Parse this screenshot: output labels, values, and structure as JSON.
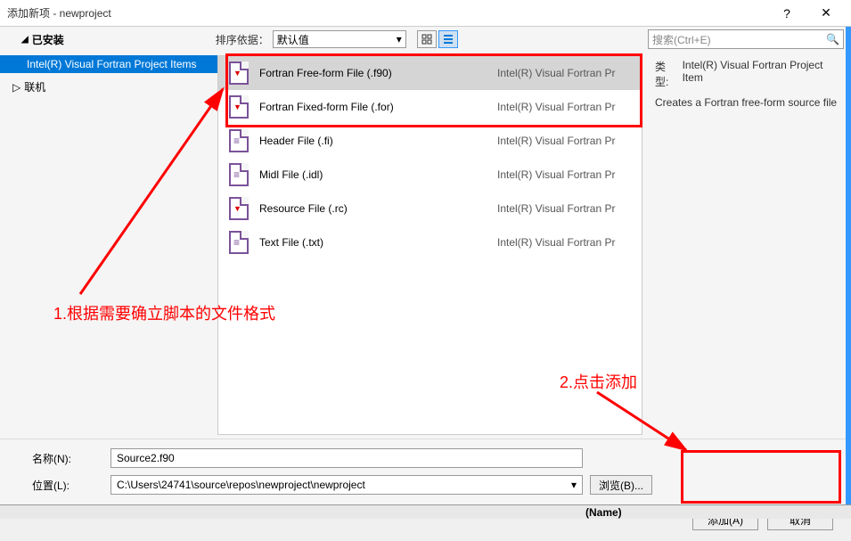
{
  "titlebar": {
    "title": "添加新项 - newproject",
    "help": "?",
    "close": "✕"
  },
  "toolbar": {
    "installed_label": "已安装",
    "sort_label": "排序依据：",
    "sort_value": "默认值",
    "search_placeholder": "搜索(Ctrl+E)"
  },
  "sidebar": {
    "items": [
      {
        "label": "Intel(R) Visual Fortran Project Items"
      }
    ],
    "online_label": "联机"
  },
  "templates": [
    {
      "name": "Fortran Free-form File (.f90)",
      "category": "Intel(R) Visual Fortran Pr",
      "icon": "resource",
      "selected": true
    },
    {
      "name": "Fortran Fixed-form File (.for)",
      "category": "Intel(R) Visual Fortran Pr",
      "icon": "resource",
      "selected": false
    },
    {
      "name": "Header File (.fi)",
      "category": "Intel(R) Visual Fortran Pr",
      "icon": "text",
      "selected": false
    },
    {
      "name": "Midl File (.idl)",
      "category": "Intel(R) Visual Fortran Pr",
      "icon": "text",
      "selected": false
    },
    {
      "name": "Resource File (.rc)",
      "category": "Intel(R) Visual Fortran Pr",
      "icon": "resource",
      "selected": false
    },
    {
      "name": "Text File (.txt)",
      "category": "Intel(R) Visual Fortran Pr",
      "icon": "text",
      "selected": false
    }
  ],
  "detail": {
    "type_label": "类型:",
    "type_value": "Intel(R) Visual Fortran Project Item",
    "description": "Creates a Fortran free-form source file"
  },
  "fields": {
    "name_label": "名称(N):",
    "name_value": "Source2.f90",
    "location_label": "位置(L):",
    "location_value": "C:\\Users\\24741\\source\\repos\\newproject\\newproject",
    "browse_label": "浏览(B)..."
  },
  "buttons": {
    "add": "添加(A)",
    "cancel": "取消"
  },
  "annotations": {
    "step1": "1.根据需要确立脚本的文件格式",
    "step2": "2.点击添加"
  },
  "bottom_strip": {
    "name_field": "(Name)"
  }
}
